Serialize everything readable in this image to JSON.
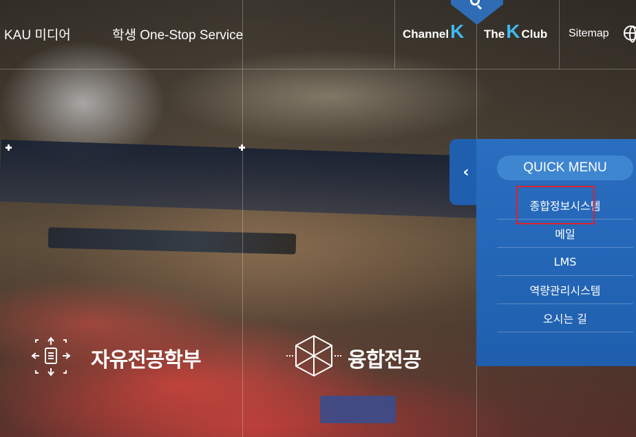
{
  "topbar": {
    "media_link": "KAU 미디어",
    "onestop_link": "학생 One-Stop Service",
    "channel_k": {
      "prefix": "Channel",
      "k": "K"
    },
    "the_k_club": {
      "prefix": "The",
      "k": "K",
      "suffix": "Club"
    },
    "sitemap": "Sitemap"
  },
  "majors": {
    "free_major": "자유전공학부",
    "convergence_major": "융합전공"
  },
  "quick_menu": {
    "title": "QUICK MENU",
    "toggle": "‹",
    "items": [
      "종합정보시스템",
      "메일",
      "LMS",
      "역량관리시스템",
      "오시는 길"
    ]
  },
  "colors": {
    "accent": "#1f5fae",
    "k_brand": "#3fb8f2",
    "highlight": "#e0202a"
  }
}
